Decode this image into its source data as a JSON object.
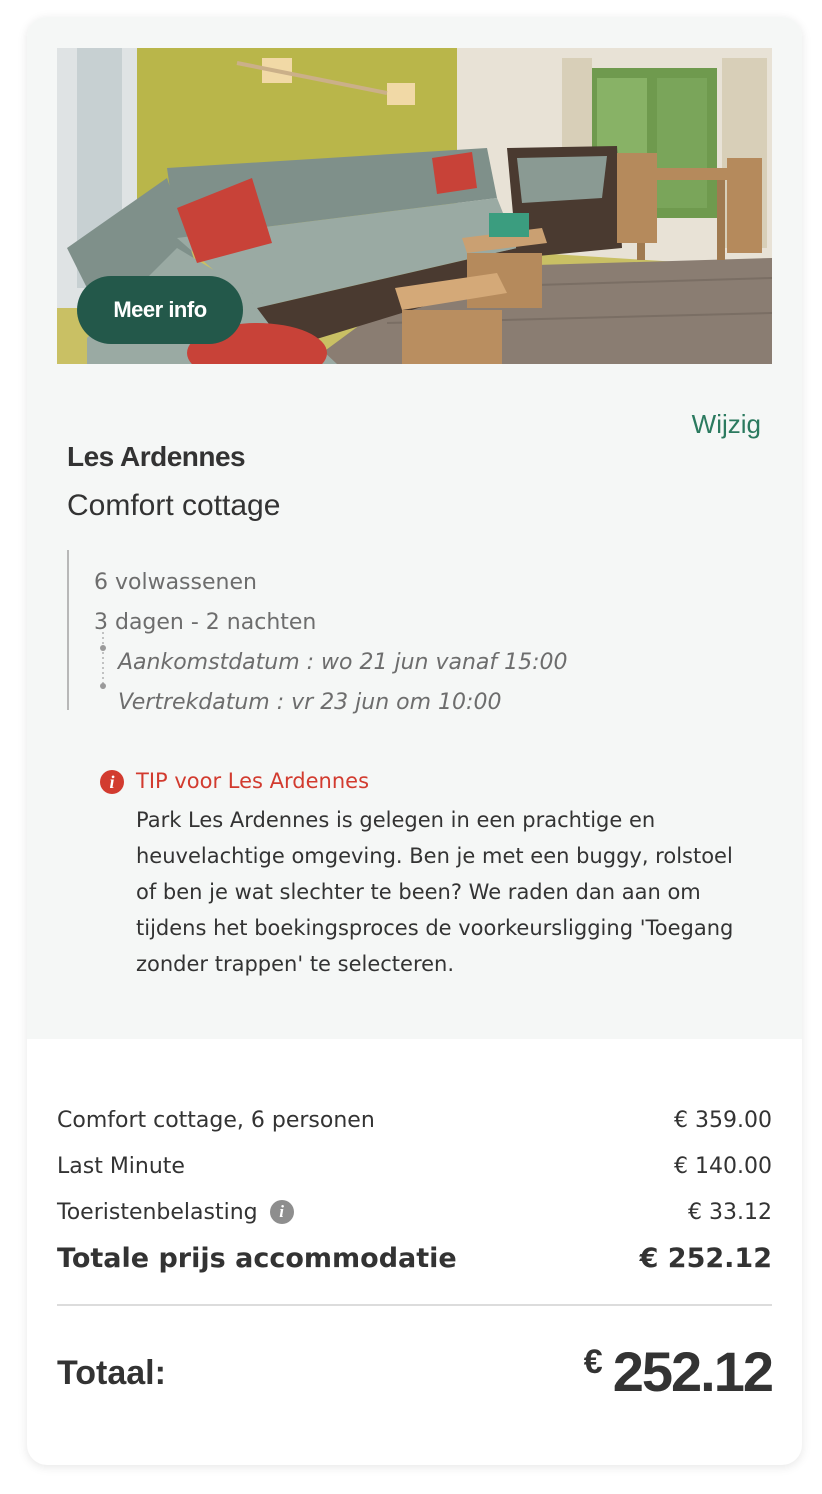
{
  "photo": {
    "alt_subject": "living-room-photo",
    "more_info_label": "Meer info"
  },
  "booking": {
    "change_label": "Wijzig",
    "park_name": "Les Ardennes",
    "accommodation": "Comfort cottage",
    "guests": "6 volwassenen",
    "duration": "3 dagen - 2 nachten",
    "arrival": "Aankomstdatum : wo 21 jun vanaf 15:00",
    "departure": "Vertrekdatum : vr 23 jun om 10:00"
  },
  "tip": {
    "icon": "info-icon",
    "title": "TIP voor Les Ardennes",
    "body": "Park Les Ardennes is gelegen in een prachtige en heuvelachtige omgeving. Ben je met een buggy, rolstoel of ben je wat slechter te been? We raden dan aan om tijdens het boekingsproces de voorkeursligging 'Toegang zonder trappen' te selecteren."
  },
  "prices": {
    "items": [
      {
        "label": "Comfort cottage, 6 personen",
        "amount": "€ 359.00"
      },
      {
        "label": "Last Minute",
        "amount": "€ 140.00"
      },
      {
        "label": "Toeristenbelasting",
        "amount": "€ 33.12"
      }
    ],
    "accommodation_total_label": "Totale prijs accommodatie",
    "accommodation_total_amount": "€ 252.12"
  },
  "total": {
    "label": "Totaal:",
    "currency": "€",
    "amount": "252.12"
  },
  "colors": {
    "accent_green": "#2b7a5f",
    "button_green": "#23584a",
    "tip_red": "#d23b2f"
  }
}
